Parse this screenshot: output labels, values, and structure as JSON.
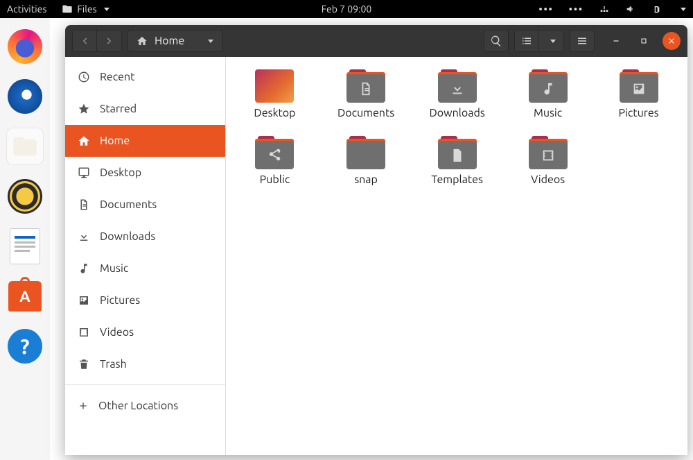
{
  "topbar": {
    "activities": "Activities",
    "app_menu": "Files",
    "datetime": "Feb 7  09:00"
  },
  "dock": {
    "apps": [
      {
        "name": "firefox"
      },
      {
        "name": "thunderbird"
      },
      {
        "name": "files",
        "active": true
      },
      {
        "name": "rhythmbox"
      },
      {
        "name": "libreoffice-writer"
      },
      {
        "name": "ubuntu-software"
      },
      {
        "name": "help"
      }
    ]
  },
  "window": {
    "path_location": "Home",
    "sidebar": [
      {
        "icon": "clock",
        "label": "Recent"
      },
      {
        "icon": "star",
        "label": "Starred"
      },
      {
        "icon": "home",
        "label": "Home",
        "selected": true
      },
      {
        "icon": "desktop",
        "label": "Desktop"
      },
      {
        "icon": "document",
        "label": "Documents"
      },
      {
        "icon": "download",
        "label": "Downloads"
      },
      {
        "icon": "music",
        "label": "Music"
      },
      {
        "icon": "picture",
        "label": "Pictures"
      },
      {
        "icon": "video",
        "label": "Videos"
      },
      {
        "icon": "trash",
        "label": "Trash"
      }
    ],
    "other_locations": "Other Locations",
    "files": [
      {
        "name": "Desktop",
        "type": "desktop"
      },
      {
        "name": "Documents",
        "type": "folder",
        "glyph": "document"
      },
      {
        "name": "Downloads",
        "type": "folder",
        "glyph": "download"
      },
      {
        "name": "Music",
        "type": "folder",
        "glyph": "music"
      },
      {
        "name": "Pictures",
        "type": "folder",
        "glyph": "picture"
      },
      {
        "name": "Public",
        "type": "folder",
        "glyph": "share"
      },
      {
        "name": "snap",
        "type": "folder",
        "glyph": "none"
      },
      {
        "name": "Templates",
        "type": "folder",
        "glyph": "template"
      },
      {
        "name": "Videos",
        "type": "folder",
        "glyph": "video"
      }
    ]
  }
}
